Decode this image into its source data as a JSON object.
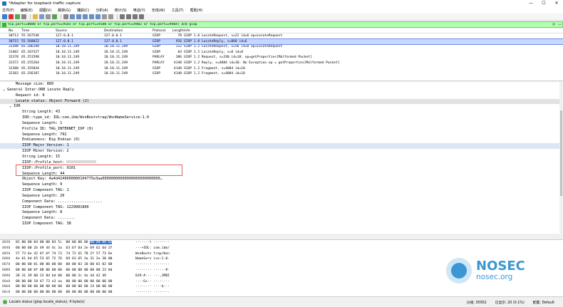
{
  "window": {
    "title": "*Adapter for loopback traffic capture",
    "controls": [
      "—",
      "☐",
      "✕"
    ]
  },
  "menu": [
    "文件(F)",
    "编辑(E)",
    "视图(V)",
    "跳转(G)",
    "捕获(C)",
    "分析(A)",
    "统计(S)",
    "电话(Y)",
    "无线(W)",
    "工具(T)",
    "帮助(H)"
  ],
  "filter": {
    "value": "tcp.port==8080 or tcp.port==9101 or tcp.port==9100 or tcp.port==9402 or tcp.port==9404) and giop",
    "clear": "✕",
    "apply": "→"
  },
  "packet_list": {
    "columns": [
      "No.",
      "Time",
      "Source",
      "Destination",
      "Protocol",
      "Length",
      "Info"
    ],
    "rows": [
      {
        "no": "30713",
        "time": "55.567546",
        "src": "127.0.0.1",
        "dst": "127.0.0.1",
        "proto": "GIOP",
        "len": "78",
        "info": "GIOP 1.0 LocateRequest, s=22 id=6 op=LocateRequest",
        "selected": false
      },
      {
        "no": "30715",
        "time": "55.568022",
        "src": "127.0.0.1",
        "dst": "127.0.0.1",
        "proto": "GIOP",
        "len": "916",
        "info": "GIOP 1.0 LocateReply, s=860 id=6",
        "selected": true
      },
      {
        "no": "31398",
        "time": "65.106198",
        "src": "10.10.11.249",
        "dst": "10.10.11.249",
        "proto": "GIOP",
        "len": "112",
        "info": "GIOP 1.2 LocateRequest, s=56 id=8 op=LocateRequest",
        "selected": false
      },
      {
        "no": "31402",
        "time": "65.107327",
        "src": "10.10.11.249",
        "dst": "10.10.11.249",
        "proto": "GIOP",
        "len": "64",
        "info": "GIOP 1.2 LocateReply, s=8 id=8",
        "selected": false
      },
      {
        "no": "32370",
        "time": "65.251598",
        "src": "10.10.11.249",
        "dst": "10.10.11.249",
        "proto": "PARLAY",
        "len": "386",
        "info": "GIOP 1.2 Request, s=330 id=10: op=getProperties[Malformed Packet]",
        "selected": false
      },
      {
        "no": "32372",
        "time": "65.255264",
        "src": "10.10.11.249",
        "dst": "10.10.11.249",
        "proto": "PARLAY",
        "len": "4148",
        "info": "GIOP 1.2 Reply, s=4084 id=10: No Exception op = getProperties[Malformed Packet]",
        "selected": false
      },
      {
        "no": "32380",
        "time": "65.355844",
        "src": "10.10.11.249",
        "dst": "10.10.11.249",
        "proto": "GIOP",
        "len": "4140",
        "info": "GIOP 1.2 Fragment, s=4084 id=10",
        "selected": false
      },
      {
        "no": "32383",
        "time": "65.356187",
        "src": "10.10.11.249",
        "dst": "10.10.11.249",
        "proto": "GIOP",
        "len": "4140",
        "info": "GIOP 1.2 Fragment, s=4084 id=10",
        "selected": false
      }
    ]
  },
  "detail": {
    "rows": [
      {
        "text": "Message size: 860",
        "indent": 2,
        "toggle": "",
        "hl": ""
      },
      {
        "text": "General Inter-ORB Locate Reply",
        "indent": 0,
        "toggle": "⌄",
        "hl": ""
      },
      {
        "text": "Request id: 6",
        "indent": 2,
        "toggle": "",
        "hl": ""
      },
      {
        "text": "Locate status: Object Forward (2)",
        "indent": 2,
        "toggle": "",
        "hl": "hl"
      },
      {
        "text": "IOR",
        "indent": 1,
        "toggle": "⌄",
        "hl": ""
      },
      {
        "text": "String Length: 43",
        "indent": 3,
        "toggle": "",
        "hl": ""
      },
      {
        "text": "IOR::type_id: IDL:com.ibm/WsnBootstrap/WsnNameService:1.0",
        "indent": 3,
        "toggle": "",
        "hl": ""
      },
      {
        "text": "Sequence Length: 1",
        "indent": 3,
        "toggle": "",
        "hl": ""
      },
      {
        "text": "Profile ID: TAG_INTERNET_IOP (0)",
        "indent": 3,
        "toggle": "",
        "hl": ""
      },
      {
        "text": "Sequence Length: 792",
        "indent": 3,
        "toggle": "",
        "hl": ""
      },
      {
        "text": "Endianness: Big Endian (0)",
        "indent": 3,
        "toggle": "",
        "hl": ""
      },
      {
        "text": "IIOP Major Version: 1",
        "indent": 3,
        "toggle": "",
        "hl": "hl2"
      },
      {
        "text": "IIOP Minor Version: 2",
        "indent": 3,
        "toggle": "",
        "hl": ""
      },
      {
        "text": "String Length: 15",
        "indent": 3,
        "toggle": "",
        "hl": ""
      },
      {
        "text": "IIOP::Profile_host:",
        "indent": 3,
        "toggle": "",
        "hl": "",
        "redacted": true
      },
      {
        "text": "IIOP::Profile_port: 9101",
        "indent": 3,
        "toggle": "",
        "hl": ""
      },
      {
        "text": "Sequence Length: 44",
        "indent": 3,
        "toggle": "",
        "hl": ""
      },
      {
        "text": "Object Key: 4a4d4249000000104775e3aa00000000000000000000000000…",
        "indent": 3,
        "toggle": "",
        "hl": ""
      },
      {
        "text": "Sequence Length: 9",
        "indent": 3,
        "toggle": "",
        "hl": ""
      },
      {
        "text": "IIOP Component TAG: 1",
        "indent": 3,
        "toggle": "",
        "hl": ""
      },
      {
        "text": "Sequence Length: 20",
        "indent": 3,
        "toggle": "",
        "hl": ""
      },
      {
        "text": "Component Data: ....................",
        "indent": 3,
        "toggle": "",
        "hl": ""
      },
      {
        "text": "IIOP Component TAG: 1229081866",
        "indent": 3,
        "toggle": "",
        "hl": ""
      },
      {
        "text": "Sequence Length: 8",
        "indent": 3,
        "toggle": "",
        "hl": ""
      },
      {
        "text": "Component Data: ........",
        "indent": 3,
        "toggle": "",
        "hl": ""
      },
      {
        "text": "IIOP Component TAG: 38",
        "indent": 3,
        "toggle": "",
        "hl": ""
      }
    ]
  },
  "hex": [
    {
      "off": "0030",
      "bytes": "01 00 00 04 00 00 03 5c  00 00 00 06 00 00 00 02",
      "ascii": "·······\\ ········"
    },
    {
      "off": "0040",
      "bytes": "00 00 00 2b 49 44 4c 3a  63 6f 6d 2e 69 62 6d 2f",
      "ascii": "···+IDL: com.ibm/"
    },
    {
      "off": "0050",
      "bytes": "57 73 6e 42 6f 6f 74 73  74 72 61 70 2f 57 73 6e",
      "ascii": "WsnBoots trap/Wsn"
    },
    {
      "off": "0060",
      "bytes": "4e 61 6d 65 53 65 72 76  69 63 65 3a 31 2e 30 00",
      "ascii": "NameServ ice:1.0·"
    },
    {
      "off": "0070",
      "bytes": "00 00 00 01 00 00 00 00  00 00 03 18 00 01 02 00",
      "ascii": "········ ········"
    },
    {
      "off": "0080",
      "bytes": "00 00 00 0f 00 00 00 00  00 00 00 00 00 00 23 8d",
      "ascii": "········ ······#·"
    },
    {
      "off": "0090",
      "bytes": "38 31 39 00 23 8d bd 00  00 00 2c 4a 4d 42 49",
      "ascii": "819·#··· ···,JMBI"
    },
    {
      "off": "00a0",
      "bytes": "00 00 00 10 47 73 e3 aa  00 00 00 00 00 00 00 00",
      "ascii": "····Gs·· ········"
    },
    {
      "off": "00b0",
      "bytes": "00 00 00 00 00 00 00 00  00 00 00 00 24 00 00 00",
      "ascii": "········ ····$···"
    },
    {
      "off": "00c0",
      "bytes": "00 00 00 00 00 00 00 00  00 00 00 00 00 00 00 00",
      "ascii": "········ ········"
    }
  ],
  "status": {
    "text": "Locate status (giop.locate_status), 4 byte(s)",
    "right": [
      "分组: 35002",
      "已显示: 20 (0.1%)",
      "配置: Default"
    ]
  },
  "watermark": {
    "brand": "NOSEC",
    "domain": "nosec.org"
  },
  "colors": {
    "filter_bg": "#afffaf",
    "selected_row": "#c8d7ff",
    "hex_select": "#3875d7",
    "brand": "#3a97d4"
  }
}
